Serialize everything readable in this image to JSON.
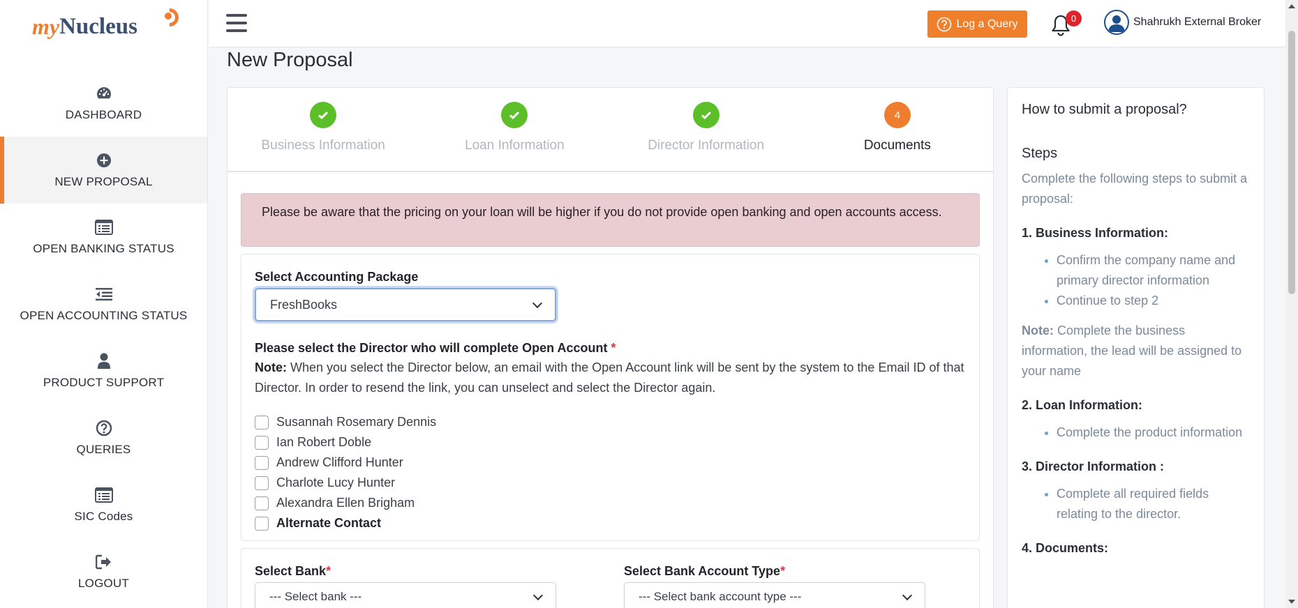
{
  "logo": {
    "my": "my",
    "nucleus": "Nucleus"
  },
  "sidebar": {
    "items": [
      {
        "label": "DASHBOARD",
        "icon": "dashboard-icon"
      },
      {
        "label": "NEW PROPOSAL",
        "icon": "plus-circle-icon",
        "active": true
      },
      {
        "label": "OPEN BANKING STATUS",
        "icon": "list-icon"
      },
      {
        "label": "OPEN ACCOUNTING STATUS",
        "icon": "indent-icon"
      },
      {
        "label": "PRODUCT SUPPORT",
        "icon": "user-icon"
      },
      {
        "label": "QUERIES",
        "icon": "question-circle-icon"
      },
      {
        "label": "SIC Codes",
        "icon": "list-icon"
      },
      {
        "label": "LOGOUT",
        "icon": "logout-icon"
      }
    ]
  },
  "topbar": {
    "log_query": "Log a Query",
    "notification_count": "0",
    "user_name": "Shahrukh External Broker"
  },
  "page": {
    "title": "New Proposal"
  },
  "stepper": {
    "steps": [
      {
        "label": "Business Information",
        "status": "done"
      },
      {
        "label": "Loan Information",
        "status": "done"
      },
      {
        "label": "Director Information",
        "status": "done"
      },
      {
        "label": "Documents",
        "status": "current",
        "number": "4"
      }
    ]
  },
  "alert": {
    "text": "Please be aware that the pricing on your loan will be higher if you do not provide open banking and open accounts access."
  },
  "accounting": {
    "label": "Select Accounting Package",
    "selected": "FreshBooks"
  },
  "directors": {
    "heading": "Please select the Director who will complete Open Account",
    "required_mark": "*",
    "note_label": "Note:",
    "note_text": "When you select the Director below, an email with the Open Account link will be sent by the system to the Email ID of that Director. In order to resend the link, you can unselect and select the Director again.",
    "list": [
      "Susannah Rosemary Dennis",
      "Ian Robert Doble",
      "Andrew Clifford Hunter",
      "Charlote Lucy Hunter",
      "Alexandra Ellen Brigham"
    ],
    "alternate": "Alternate Contact"
  },
  "bank": {
    "bank_label": "Select Bank",
    "bank_placeholder": "--- Select bank ---",
    "type_label": "Select Bank Account Type",
    "type_placeholder": "--- Select bank account type ---",
    "required_mark": "*"
  },
  "help": {
    "title": "How to submit a proposal?",
    "steps_heading": "Steps",
    "intro": "Complete the following steps to submit a proposal:",
    "s1_title": "1. Business Information:",
    "s1_items": [
      "Confirm the company name and primary director information",
      "Continue to step 2"
    ],
    "note_label": "Note:",
    "note_text": "Complete the business information, the lead will be assigned to your name",
    "s2_title": "2. Loan Information:",
    "s2_items": [
      "Complete the product information"
    ],
    "s3_title": "3. Director Information :",
    "s3_items": [
      "Complete all required fields relating to the director."
    ],
    "s4_title": "4. Documents:"
  },
  "colors": {
    "accent": "#ef7d2f",
    "success": "#5cbf2a",
    "alert_bg": "#eacdd0",
    "badge": "#e0222a"
  }
}
